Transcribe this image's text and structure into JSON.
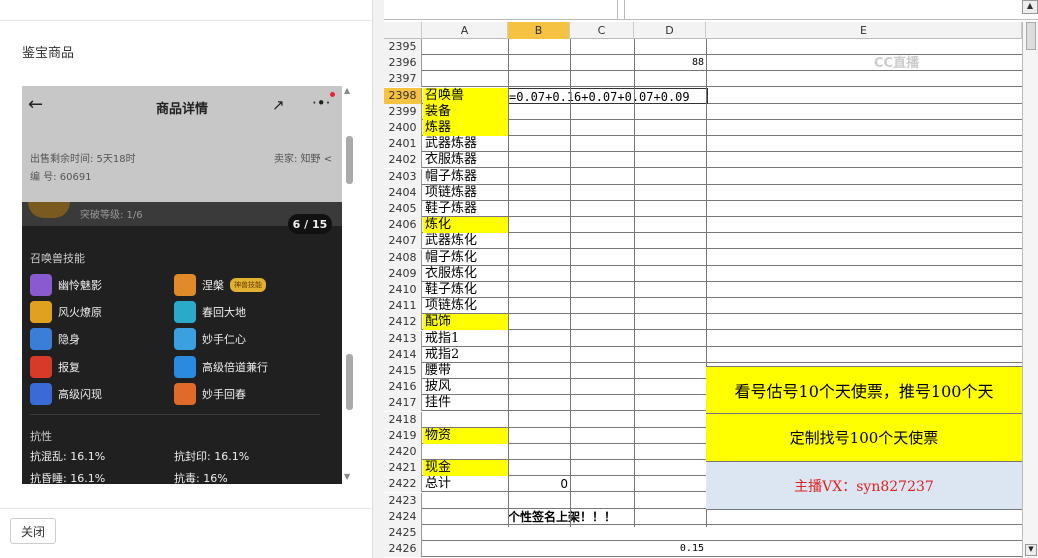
{
  "left_panel": {
    "title": "鉴宝商品",
    "close_label": "关闭",
    "phone": {
      "back_icon": "←",
      "title": "商品详情",
      "share_icon": "↗",
      "more_icon": "·•·",
      "sale_time": "出售剩余时间: 5天18时",
      "seller": "卖家: 知野 <",
      "item_no": "编 号: 60691",
      "breakthrough": "突破等级:  1/6",
      "pager": "6 / 15",
      "skills_title": "召唤兽技能",
      "skills": [
        {
          "name": "幽怜魅影",
          "color": "#8a5bd0"
        },
        {
          "name": "涅槃",
          "color": "#e08a2a",
          "badge": "神兽技能"
        },
        {
          "name": "风火燎原",
          "color": "#e0a020"
        },
        {
          "name": "春回大地",
          "color": "#2aa9c8"
        },
        {
          "name": "隐身",
          "color": "#3a7ed8"
        },
        {
          "name": "妙手仁心",
          "color": "#3aa0e0"
        },
        {
          "name": "报复",
          "color": "#d83a2a"
        },
        {
          "name": "高级倍道兼行",
          "color": "#2a8ae0"
        },
        {
          "name": "高级闪现",
          "color": "#3a6ad8"
        },
        {
          "name": "妙手回春",
          "color": "#e06a2a"
        }
      ],
      "resist_title": "抗性",
      "resists": [
        "抗混乱: 16.1%",
        "抗封印: 16.1%",
        "抗昏睡: 16.1%",
        "抗毒: 16%"
      ]
    }
  },
  "sheet": {
    "columns": [
      "A",
      "B",
      "C",
      "D",
      "E"
    ],
    "rows": [
      {
        "n": "2395",
        "a": ""
      },
      {
        "n": "2396",
        "a": "",
        "d": "88"
      },
      {
        "n": "2397",
        "a": ""
      },
      {
        "n": "2398",
        "a": "召唤兽",
        "yellow": true,
        "selected": true
      },
      {
        "n": "2399",
        "a": "装备",
        "yellow": true
      },
      {
        "n": "2400",
        "a": "炼器",
        "yellow": true
      },
      {
        "n": "2401",
        "a": "武器炼器"
      },
      {
        "n": "2402",
        "a": "衣服炼器"
      },
      {
        "n": "2403",
        "a": "帽子炼器"
      },
      {
        "n": "2404",
        "a": "项链炼器"
      },
      {
        "n": "2405",
        "a": "鞋子炼器"
      },
      {
        "n": "2406",
        "a": "炼化",
        "yellow": true
      },
      {
        "n": "2407",
        "a": "武器炼化"
      },
      {
        "n": "2408",
        "a": "帽子炼化"
      },
      {
        "n": "2409",
        "a": "衣服炼化"
      },
      {
        "n": "2410",
        "a": "鞋子炼化"
      },
      {
        "n": "2411",
        "a": "项链炼化"
      },
      {
        "n": "2412",
        "a": "配饰",
        "yellow": true
      },
      {
        "n": "2413",
        "a": "戒指1"
      },
      {
        "n": "2414",
        "a": "戒指2"
      },
      {
        "n": "2415",
        "a": "腰带"
      },
      {
        "n": "2416",
        "a": "披风"
      },
      {
        "n": "2417",
        "a": "挂件"
      },
      {
        "n": "2418",
        "a": ""
      },
      {
        "n": "2419",
        "a": "物资",
        "yellow": true
      },
      {
        "n": "2420",
        "a": ""
      },
      {
        "n": "2421",
        "a": "现金",
        "yellow": true
      },
      {
        "n": "2422",
        "a": "总计",
        "b": "0"
      },
      {
        "n": "2423",
        "a": ""
      },
      {
        "n": "2424",
        "a": "",
        "b": "个性签名上架！！！"
      },
      {
        "n": "2425",
        "a": ""
      },
      {
        "n": "2426",
        "a": "",
        "d": "0.15"
      }
    ],
    "formula": "=0.07+0.16+0.07+0.07+0.09",
    "banner1": "看号估号10个天使票，推号100个天",
    "banner2": "定制找号100个天使票",
    "banner3": "主播VX：syn827237",
    "watermark": "CC直播",
    "colors": {
      "yellow": "#ffff00",
      "selected_row": "#f5c242",
      "banner3_bg": "#dce6f2",
      "banner3_text": "#e02020"
    }
  }
}
